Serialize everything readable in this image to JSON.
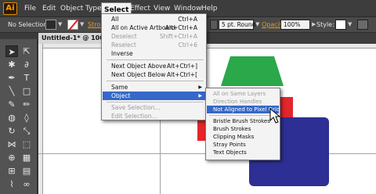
{
  "app": {
    "logo": "Ai"
  },
  "menubar": {
    "items": [
      "File",
      "Edit",
      "Object",
      "Type",
      "Select",
      "Effect",
      "View",
      "Window",
      "Help"
    ],
    "active": "Select"
  },
  "controlbar": {
    "selection_label": "No Selection",
    "stroke_label": "Stroke:",
    "stroke_style": "5 pt. Round",
    "opacity_label": "Opacity:",
    "opacity_value": "100%",
    "style_label": "Style:"
  },
  "document": {
    "tab_title": "Untitled-1* @ 100% ("
  },
  "select_menu": {
    "items": [
      {
        "label": "All",
        "shortcut": "Ctrl+A",
        "disabled": false
      },
      {
        "label": "All on Active Artboard",
        "shortcut": "Alt+Ctrl+A",
        "disabled": false
      },
      {
        "label": "Deselect",
        "shortcut": "Shift+Ctrl+A",
        "disabled": true
      },
      {
        "label": "Reselect",
        "shortcut": "Ctrl+6",
        "disabled": true
      },
      {
        "label": "Inverse",
        "shortcut": "",
        "disabled": false
      },
      {
        "label": "Next Object Above",
        "shortcut": "Alt+Ctrl+]",
        "disabled": false
      },
      {
        "label": "Next Object Below",
        "shortcut": "Alt+Ctrl+[",
        "disabled": false
      },
      {
        "label": "Same",
        "shortcut": "",
        "disabled": false
      },
      {
        "label": "Object",
        "shortcut": "",
        "disabled": false
      },
      {
        "label": "Save Selection...",
        "shortcut": "",
        "disabled": true
      },
      {
        "label": "Edit Selection...",
        "shortcut": "",
        "disabled": true
      }
    ],
    "highlighted": "Object"
  },
  "object_submenu": {
    "items": [
      {
        "label": "All on Same Layers",
        "disabled": true
      },
      {
        "label": "Direction Handles",
        "disabled": true
      },
      {
        "label": "Not Aligned to Pixel Grid",
        "disabled": false
      },
      {
        "label": "Bristle Brush Strokes",
        "disabled": false
      },
      {
        "label": "Brush Strokes",
        "disabled": false
      },
      {
        "label": "Clipping Masks",
        "disabled": false
      },
      {
        "label": "Stray Points",
        "disabled": false
      },
      {
        "label": "Text Objects",
        "disabled": false
      }
    ],
    "highlighted": "Not Aligned to Pixel Grid"
  },
  "colors": {
    "accent": "#3568c8",
    "green_shape": "#2aa84a",
    "red_shape": "#e2262b",
    "blue_shape": "#2d2f95",
    "app_orange": "#ff9a00"
  }
}
